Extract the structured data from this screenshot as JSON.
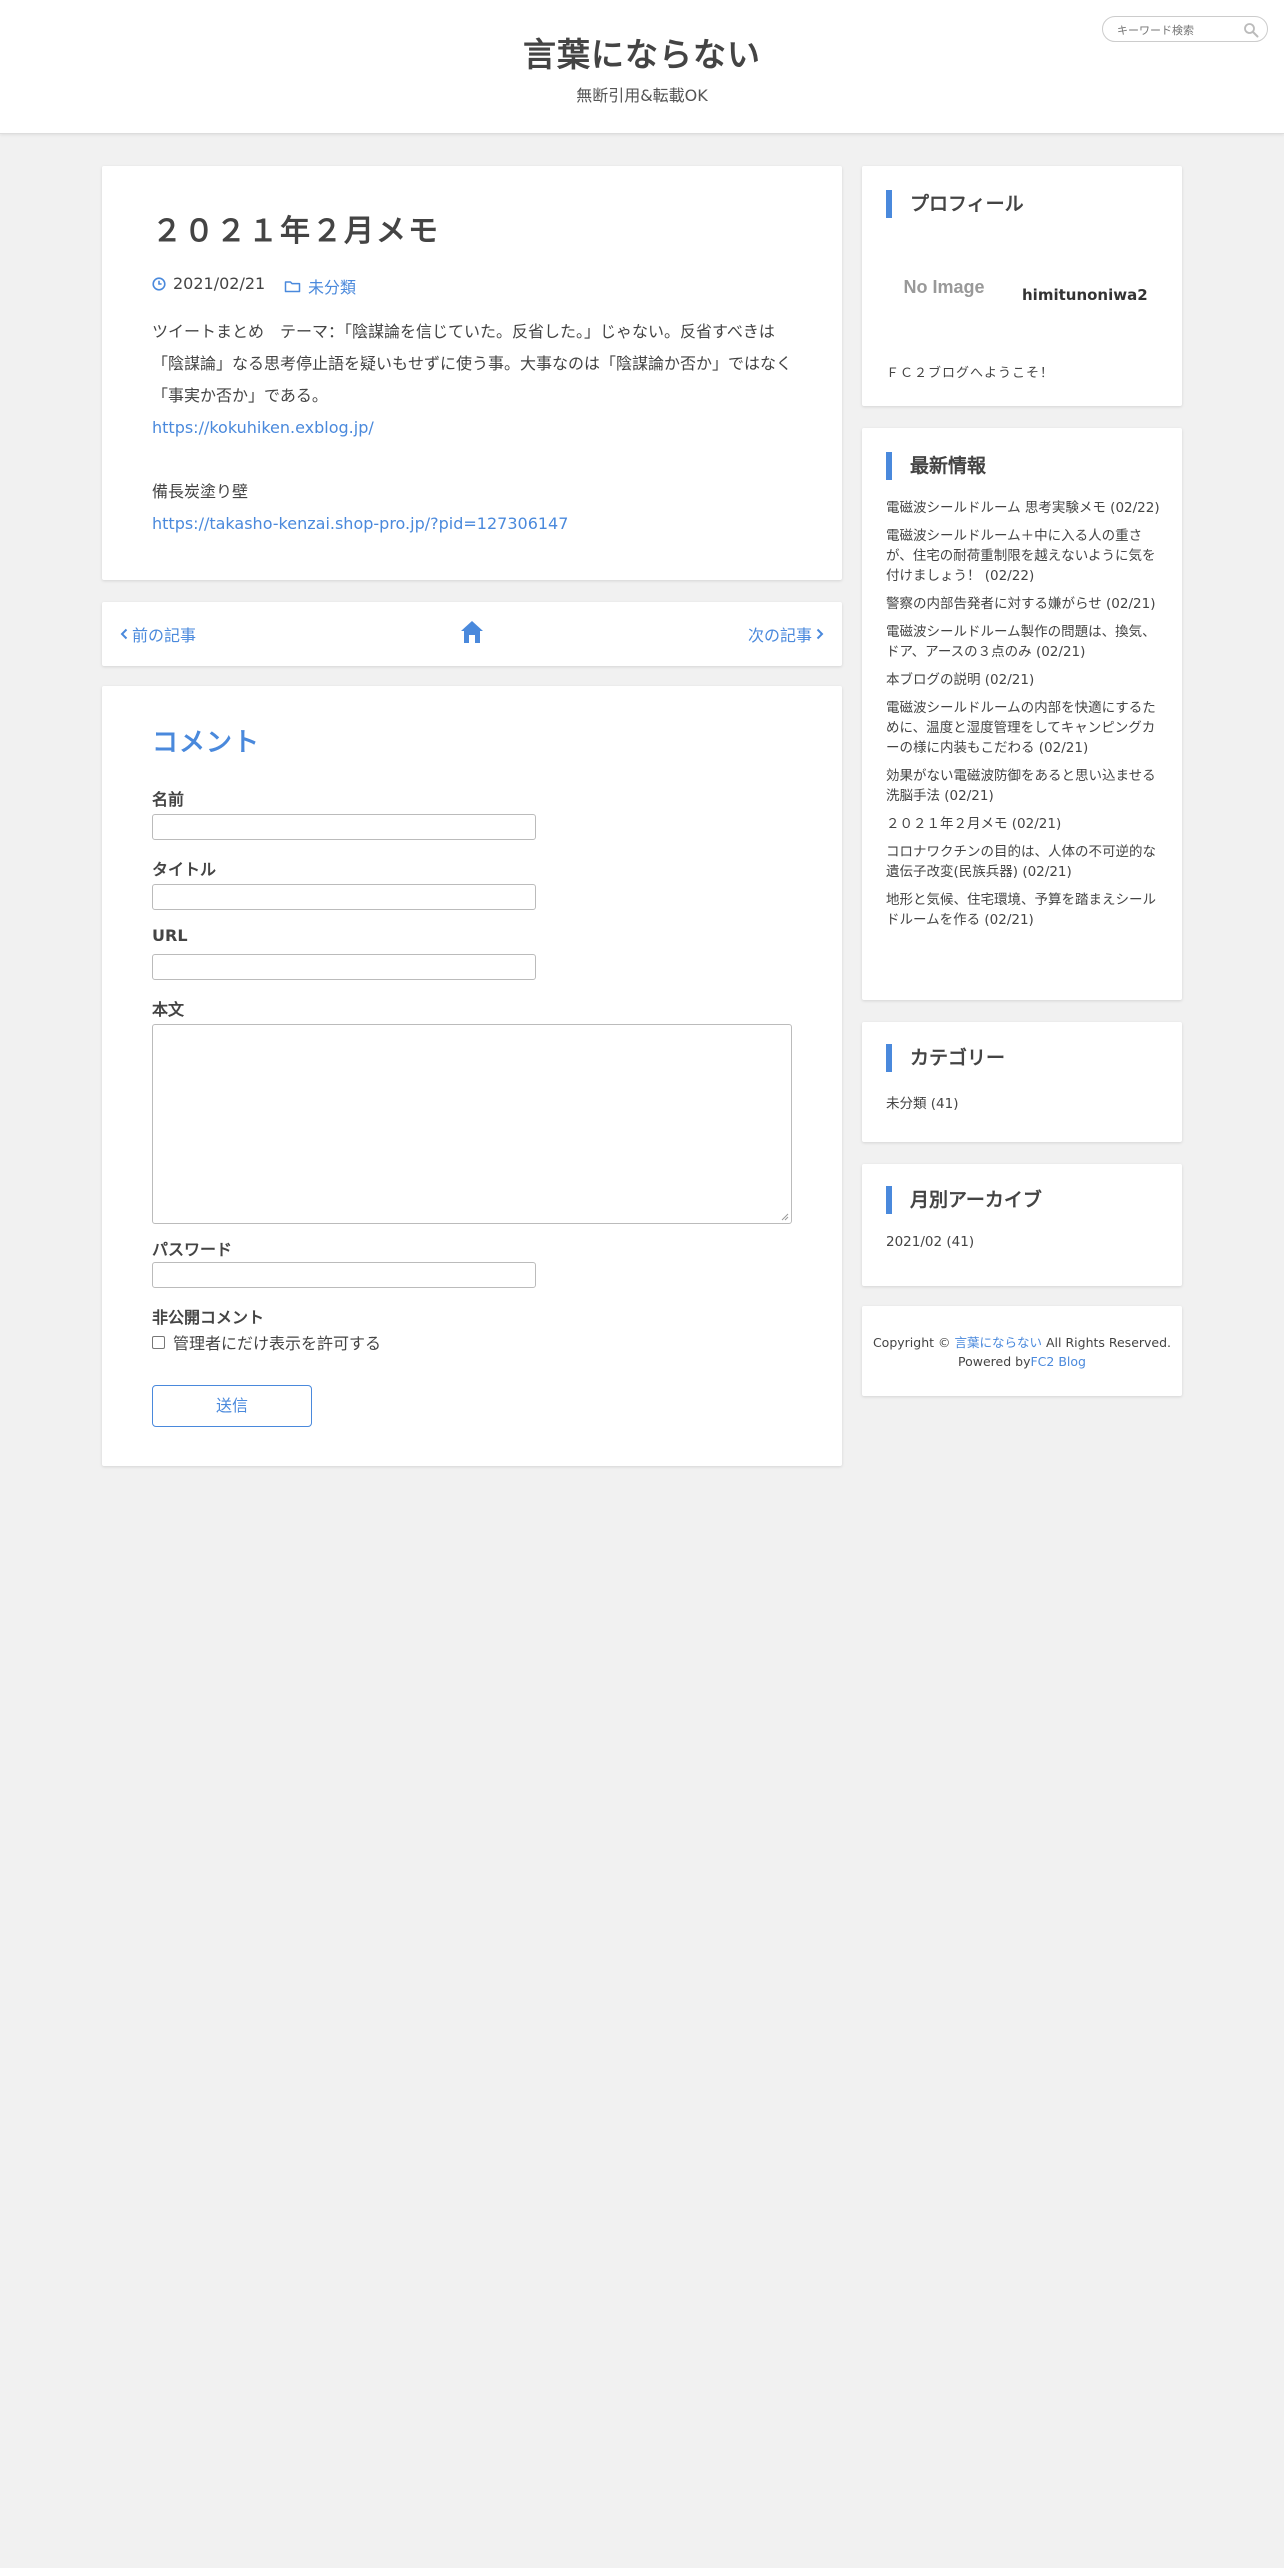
{
  "header": {
    "site_title": "言葉にならない",
    "site_description": "無断引用&転載OK",
    "search_placeholder": "キーワード検索"
  },
  "article": {
    "title": "２０２１年２月メモ",
    "date": "2021/02/21",
    "category": "未分類",
    "body": {
      "para1": "ツイートまとめ　テーマ：「陰謀論を信じていた。反省した。」じゃない。反省すべきは「陰謀論」なる思考停止語を疑いもせずに使う事。大事なのは「陰謀論か否か」ではなく「事実か否か」である。",
      "link1": "https://kokuhiken.exblog.jp/",
      "para2": "備長炭塗り壁",
      "link2": "https://takasho-kenzai.shop-pro.jp/?pid=127306147"
    }
  },
  "pager": {
    "prev_label": "前の記事",
    "next_label": "次の記事"
  },
  "comment_form": {
    "heading": "コメント",
    "name_label": "名前",
    "title_label": "タイトル",
    "url_label": "URL",
    "body_label": "本文",
    "password_label": "パスワード",
    "private_label": "非公開コメント",
    "private_checkbox_label": "管理者にだけ表示を許可する",
    "submit_label": "送信"
  },
  "sidebar": {
    "profile": {
      "title": "プロフィール",
      "image_text": "No Image",
      "name": "himitunoniwa2",
      "message": "ＦＣ２ブログへようこそ！"
    },
    "recent": {
      "title": "最新情報",
      "items": [
        "電磁波シールドルーム 思考実験メモ (02/22)",
        "電磁波シールドルーム＋中に入る人の重さが、住宅の耐荷重制限を越えないように気を付けましょう！ (02/22)",
        "警察の内部告発者に対する嫌がらせ (02/21)",
        "電磁波シールドルーム製作の問題は、換気、ドア、アースの３点のみ (02/21)",
        "本ブログの説明 (02/21)",
        "電磁波シールドルームの内部を快適にするために、温度と湿度管理をしてキャンピングカーの様に内装もこだわる (02/21)",
        "効果がない電磁波防御をあると思い込ませる洗脳手法 (02/21)",
        "２０２１年２月メモ (02/21)",
        "コロナワクチンの目的は、人体の不可逆的な遺伝子改変(民族兵器) (02/21)",
        "地形と気候、住宅環境、予算を踏まえシールドルームを作る (02/21)"
      ]
    },
    "categories": {
      "title": "カテゴリー",
      "item": "未分類 (41)"
    },
    "archive": {
      "title": "月別アーカイブ",
      "item": "2021/02 (41)"
    },
    "footer": {
      "copyright_prefix": "Copyright ©",
      "site_link": "言葉にならない",
      "copyright_suffix": "All Rights Reserved.",
      "powered_by": "Powered by",
      "powered_link": "FC2 Blog"
    }
  },
  "colors": {
    "accent": "#4a89dc",
    "background": "#f1f1f1",
    "text": "#444444"
  }
}
